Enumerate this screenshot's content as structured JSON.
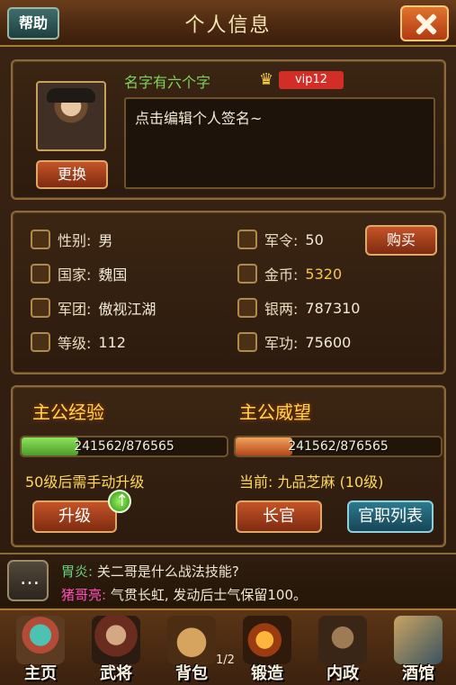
{
  "header": {
    "help_label": "帮助",
    "title": "个人信息"
  },
  "profile": {
    "name": "名字有六个字",
    "vip_label": "vip12",
    "change_label": "更换",
    "signature_placeholder": "点击编辑个人签名~"
  },
  "info": {
    "gender_label": "性别:",
    "gender_value": "男",
    "country_label": "国家:",
    "country_value": "魏国",
    "legion_label": "军团:",
    "legion_value": "傲视江湖",
    "level_label": "等级:",
    "level_value": "112",
    "military_order_label": "军令:",
    "military_order_value": "50",
    "buy_label": "购买",
    "gold_label": "金币:",
    "gold_value": "5320",
    "silver_label": "银两:",
    "silver_value": "787310",
    "merit_label": "军功:",
    "merit_value": "75600"
  },
  "progress": {
    "exp_title": "主公经验",
    "prestige_title": "主公威望",
    "exp_text": "241562/876565",
    "prestige_text": "241562/876565",
    "exp_fraction": 0.276,
    "prestige_fraction": 0.276,
    "manual_upgrade_text": "50级后需手动升级",
    "current_rank_text": "当前: 九品芝麻 (10级)",
    "upgrade_label": "升级",
    "officer_label": "长官",
    "rank_list_label": "官职列表"
  },
  "chat": {
    "line1_name": "胃炎:",
    "line1_text": "关二哥是什么战法技能?",
    "line2_name": "猪哥亮:",
    "line2_text": "气贯长虹, 发动后士气保留100。"
  },
  "nav": {
    "home": "主页",
    "generals": "武将",
    "bag": "背包",
    "forge": "锻造",
    "internal": "内政",
    "tavern": "酒馆",
    "page_indicator": "1/2"
  },
  "colors": {
    "accent_gold": "#f5c64e",
    "green_bar": "#8ce45b",
    "orange_bar": "#f0a35b"
  }
}
